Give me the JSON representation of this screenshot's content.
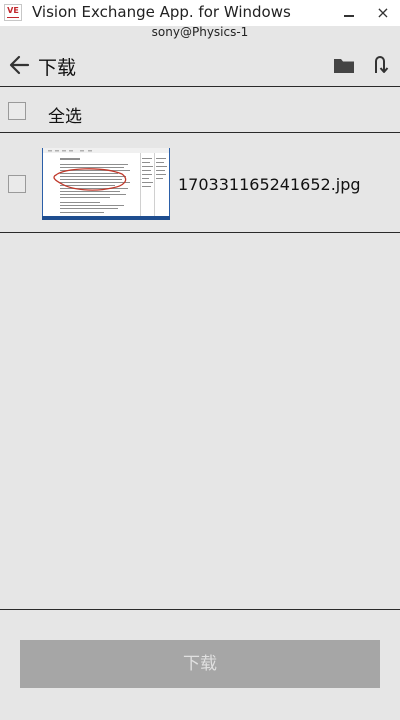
{
  "window": {
    "logo_text": "VE",
    "title": "Vision Exchange App. for Windows",
    "close_glyph": "×"
  },
  "device": {
    "name": "sony@Physics-1"
  },
  "toolbar": {
    "title": "下载"
  },
  "select_all": {
    "label": "全选"
  },
  "files": [
    {
      "name": "170331165241652.jpg"
    }
  ],
  "download_button": {
    "label": "下载"
  },
  "colors": {
    "background": "#e6e6e6",
    "titlebar": "#ffffff",
    "button_disabled": "#a6a6a6",
    "logo_red": "#c1272d",
    "thumbnail_annotation": "#c0392b"
  },
  "icons": {
    "back": "arrow-left-icon",
    "folder": "folder-icon",
    "refresh": "refresh-icon"
  }
}
